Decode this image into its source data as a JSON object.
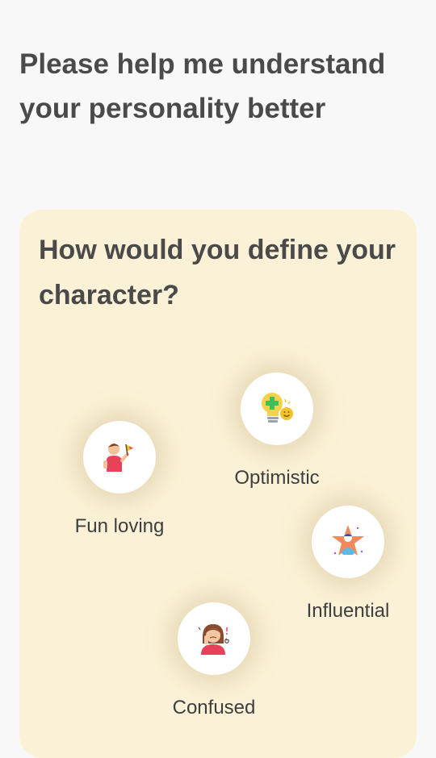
{
  "header": {
    "title": "Please help me understand your personality better"
  },
  "card": {
    "question": "How would you define your character?",
    "options": [
      {
        "label": "Fun loving",
        "icon": "waving-boy-icon"
      },
      {
        "label": "Optimistic",
        "icon": "lightbulb-smile-icon"
      },
      {
        "label": "Influential",
        "icon": "star-person-icon"
      },
      {
        "label": "Confused",
        "icon": "confused-girl-icon"
      }
    ]
  },
  "colors": {
    "background": "#f8f8f8",
    "card": "#fbf1d6",
    "text": "#4a4a4a"
  }
}
